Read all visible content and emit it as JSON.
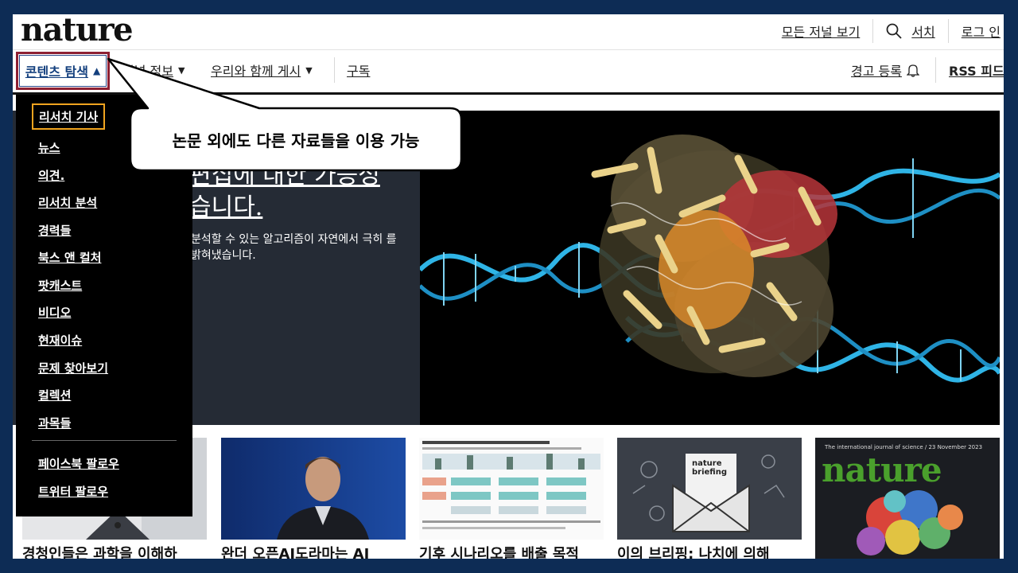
{
  "header": {
    "logo": "nature",
    "all_journals": "모든 저널 보기",
    "search": "서치",
    "login": "로그 인"
  },
  "nav": {
    "explore": "콘텐츠 탐색",
    "journal_info": "저널 정보",
    "publish": "우리와 함께 게시",
    "subscribe": "구독",
    "alerts": "경고 등록",
    "rss": "RSS 피드"
  },
  "dropdown": {
    "items": [
      "리서치 기사",
      "뉴스",
      "의견.",
      "리서치 분석",
      "경력들",
      "북스 앤 컬처",
      "팟캐스트",
      "비디오",
      "현재이슈",
      "문제 찾아보기",
      "컬렉션",
      "과목들"
    ],
    "social": [
      "페이스북 팔로우",
      "트위터 팔로우"
    ]
  },
  "hero": {
    "title_line1": "편집에 대한 가능성",
    "title_line2": "습니다.",
    "desc": "분석할 수 있는 알고리즘이 자연에서 극히 를 밝혀냈습니다."
  },
  "callout": {
    "text": "논문 외에도 다른 자료들을 이용 가능"
  },
  "cards": [
    {
      "title": "경청인들은 과학을 이해하"
    },
    {
      "title": "완더 오픈AI도라마는 AI"
    },
    {
      "title": "기후 시나리오를 배출 목적"
    },
    {
      "title": "이의 브리핑: 나치에 의해"
    },
    {
      "title": ""
    }
  ],
  "card_briefing": {
    "label_line1": "nature",
    "label_line2": "briefing"
  },
  "cover": {
    "date": "The international journal of science / 23 November 2023",
    "logo": "nature"
  },
  "colors": {
    "outer_bg": "#0d2c55",
    "explore_border": "#8e2033",
    "active_border": "#f0a41f",
    "hero_panel": "#252b35",
    "dna_blue": "#2fb4e6"
  }
}
